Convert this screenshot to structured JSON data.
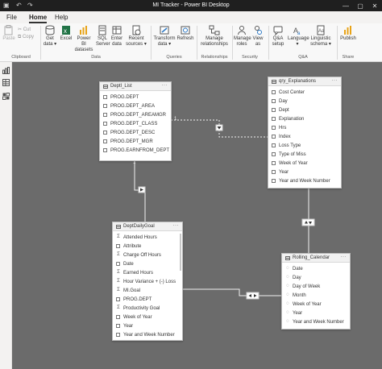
{
  "app": {
    "title": "MI Tracker - Power BI Desktop",
    "quick_access": [
      "save-icon",
      "undo-icon",
      "redo-icon"
    ],
    "window_controls": [
      "minimize-icon",
      "maximize-icon",
      "close-icon"
    ]
  },
  "ribbon_tabs": [
    "File",
    "Home",
    "Help"
  ],
  "active_tab": "Home",
  "ribbon": {
    "clipboard": {
      "paste": "Paste",
      "cut": "Cut",
      "copy": "Copy",
      "label": "Clipboard"
    },
    "data": {
      "get_data": "Get data ▾",
      "excel": "Excel",
      "pbi_datasets": "Power BI datasets",
      "sql_server": "SQL Server",
      "enter_data": "Enter data",
      "recent_sources": "Recent sources ▾",
      "label": "Data"
    },
    "queries": {
      "transform": "Transform data ▾",
      "refresh": "Refresh",
      "label": "Queries"
    },
    "relationships": {
      "manage": "Manage relationships",
      "label": "Relationships"
    },
    "security": {
      "manage_roles": "Manage roles",
      "view_as": "View as",
      "label": "Security"
    },
    "qa": {
      "qa_setup": "Q&A setup",
      "language": "Language ▾",
      "linguistic": "Linguistic schema ▾",
      "label": "Q&A"
    },
    "share": {
      "publish": "Publish",
      "label": "Share"
    },
    "accent_colors": {
      "yellow": "#e8a317",
      "green": "#217346",
      "blue": "#2b78c4"
    }
  },
  "left_rail": [
    "report-view-icon",
    "data-view-icon",
    "model-view-icon"
  ],
  "tables": {
    "deptl_list": {
      "name": "Deptl_List",
      "fields": [
        "PROG.DEPT",
        "PROG.DEPT_AREA",
        "PROG.DEPT_AREAMGR",
        "PROG.DEPT_CLASS",
        "PROG.DEPT_DESC",
        "PROG.DEPT_MGR",
        "PROG.EARNFROM_DEPT"
      ]
    },
    "qry_explanations": {
      "name": "qry_Explanations",
      "fields": [
        "Cost Center",
        "Day",
        "Dept",
        "Explanation",
        "Hrs",
        "Index",
        "Loss Type",
        "Type of Miss",
        "Week of Year",
        "Year",
        "Year and Week Number"
      ]
    },
    "dept_daily_goal": {
      "name": "DeptDailyGoal",
      "fields": [
        "Attended Hours",
        "Attribute",
        "Charge Off Hours",
        "Date",
        "Earned Hours",
        "Hour Variance + (-) Loss",
        "MI.Goal",
        "PROG.DEPT",
        "Productivity Goal",
        "Week of Year",
        "Year",
        "Year and Week Number"
      ]
    },
    "rolling_calendar": {
      "name": "Rolling_Calendar",
      "fields": [
        "Date",
        "Day",
        "Day of Week",
        "Month",
        "Week of Year",
        "Year",
        "Year and Week Number"
      ]
    }
  },
  "relationships": {
    "cardinality_one": "1",
    "more_menu": "···"
  }
}
